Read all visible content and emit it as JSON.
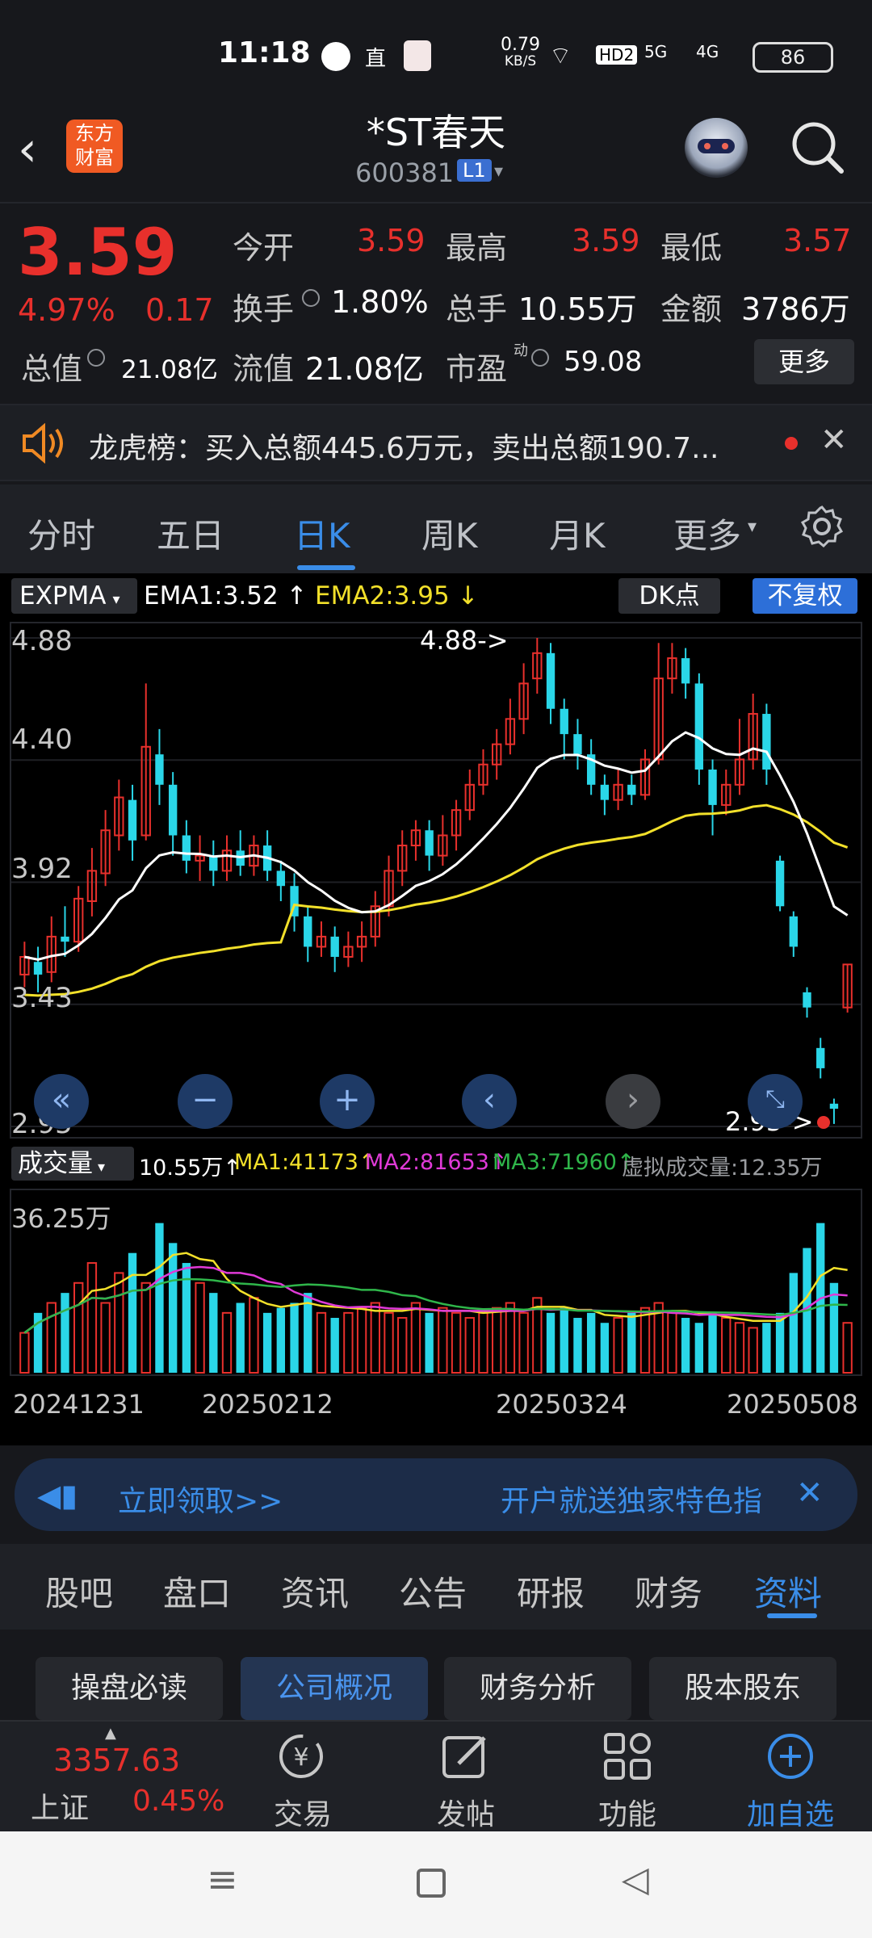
{
  "status_bar": {
    "time": "11:18",
    "net_speed": "0.79",
    "net_unit": "KB/S",
    "direct_label": "直",
    "hd": "HD2",
    "sig1": "5G",
    "sig2": "4G",
    "battery": "86"
  },
  "header": {
    "back_icon": "chevron-left-icon",
    "logo_line1": "东方",
    "logo_line2": "财富",
    "title": "*ST春天",
    "code": "600381",
    "level_badge": "L1"
  },
  "quote": {
    "price": "3.59",
    "change_pct": "4.97%",
    "change": "0.17",
    "market_cap_label": "总值",
    "market_cap": "21.08亿",
    "open_label": "今开",
    "open": "3.59",
    "high_label": "最高",
    "high": "3.59",
    "low_label": "最低",
    "low": "3.57",
    "turnover_label": "换手",
    "turnover": "1.80%",
    "volume_label": "总手",
    "volume": "10.55万",
    "amount_label": "金额",
    "amount": "3786万",
    "float_cap_label": "流值",
    "float_cap": "21.08亿",
    "pe_label": "市盈",
    "pe_sup": "动",
    "pe": "59.08",
    "more_label": "更多"
  },
  "dragon_tiger": {
    "text": "龙虎榜：买入总额445.6万元，卖出总额190.7..."
  },
  "period_tabs": [
    "分时",
    "五日",
    "日K",
    "周K",
    "月K",
    "更多"
  ],
  "active_period": "日K",
  "indicator": {
    "name": "EXPMA",
    "ema1": "EMA1:3.52",
    "ema2": "EMA2:3.95",
    "dk_label": "DK点",
    "adjust_label": "不复权"
  },
  "chart_data": {
    "type": "candlestick",
    "y_ticks": [
      "4.88",
      "4.40",
      "3.92",
      "3.43",
      "2.95"
    ],
    "ylim": [
      2.95,
      4.88
    ],
    "high_marker": "4.88->",
    "low_marker": "2.95->",
    "x_ticks": [
      "20241231",
      "20250212",
      "20250324",
      "20250508"
    ],
    "candles": [
      {
        "o": 3.55,
        "c": 3.62,
        "h": 3.68,
        "l": 3.5
      },
      {
        "o": 3.6,
        "c": 3.55,
        "h": 3.66,
        "l": 3.48
      },
      {
        "o": 3.56,
        "c": 3.7,
        "h": 3.78,
        "l": 3.52
      },
      {
        "o": 3.7,
        "c": 3.68,
        "h": 3.82,
        "l": 3.62
      },
      {
        "o": 3.68,
        "c": 3.85,
        "h": 3.9,
        "l": 3.64
      },
      {
        "o": 3.84,
        "c": 3.96,
        "h": 4.05,
        "l": 3.78
      },
      {
        "o": 3.95,
        "c": 4.12,
        "h": 4.2,
        "l": 3.9
      },
      {
        "o": 4.1,
        "c": 4.25,
        "h": 4.32,
        "l": 4.04
      },
      {
        "o": 4.24,
        "c": 4.08,
        "h": 4.3,
        "l": 4.0
      },
      {
        "o": 4.1,
        "c": 4.45,
        "h": 4.7,
        "l": 4.08
      },
      {
        "o": 4.42,
        "c": 4.3,
        "h": 4.52,
        "l": 4.22
      },
      {
        "o": 4.3,
        "c": 4.1,
        "h": 4.35,
        "l": 4.02
      },
      {
        "o": 4.1,
        "c": 4.0,
        "h": 4.16,
        "l": 3.95
      },
      {
        "o": 4.0,
        "c": 4.02,
        "h": 4.1,
        "l": 3.92
      },
      {
        "o": 4.02,
        "c": 3.96,
        "h": 4.08,
        "l": 3.9
      },
      {
        "o": 3.96,
        "c": 4.04,
        "h": 4.1,
        "l": 3.92
      },
      {
        "o": 4.04,
        "c": 3.98,
        "h": 4.12,
        "l": 3.94
      },
      {
        "o": 3.98,
        "c": 4.06,
        "h": 4.1,
        "l": 3.94
      },
      {
        "o": 4.06,
        "c": 3.96,
        "h": 4.12,
        "l": 3.92
      },
      {
        "o": 3.96,
        "c": 3.9,
        "h": 4.0,
        "l": 3.84
      },
      {
        "o": 3.9,
        "c": 3.78,
        "h": 3.95,
        "l": 3.72
      },
      {
        "o": 3.78,
        "c": 3.66,
        "h": 3.82,
        "l": 3.6
      },
      {
        "o": 3.66,
        "c": 3.7,
        "h": 3.76,
        "l": 3.62
      },
      {
        "o": 3.7,
        "c": 3.62,
        "h": 3.74,
        "l": 3.56
      },
      {
        "o": 3.62,
        "c": 3.66,
        "h": 3.72,
        "l": 3.58
      },
      {
        "o": 3.66,
        "c": 3.7,
        "h": 3.76,
        "l": 3.6
      },
      {
        "o": 3.7,
        "c": 3.82,
        "h": 3.88,
        "l": 3.66
      },
      {
        "o": 3.82,
        "c": 3.96,
        "h": 4.02,
        "l": 3.78
      },
      {
        "o": 3.96,
        "c": 4.06,
        "h": 4.12,
        "l": 3.9
      },
      {
        "o": 4.06,
        "c": 4.12,
        "h": 4.16,
        "l": 4.0
      },
      {
        "o": 4.12,
        "c": 4.02,
        "h": 4.16,
        "l": 3.96
      },
      {
        "o": 4.02,
        "c": 4.1,
        "h": 4.18,
        "l": 3.98
      },
      {
        "o": 4.1,
        "c": 4.2,
        "h": 4.24,
        "l": 4.04
      },
      {
        "o": 4.2,
        "c": 4.3,
        "h": 4.36,
        "l": 4.16
      },
      {
        "o": 4.3,
        "c": 4.38,
        "h": 4.44,
        "l": 4.26
      },
      {
        "o": 4.38,
        "c": 4.46,
        "h": 4.52,
        "l": 4.32
      },
      {
        "o": 4.46,
        "c": 4.56,
        "h": 4.64,
        "l": 4.42
      },
      {
        "o": 4.56,
        "c": 4.7,
        "h": 4.78,
        "l": 4.5
      },
      {
        "o": 4.72,
        "c": 4.82,
        "h": 4.88,
        "l": 4.66
      },
      {
        "o": 4.82,
        "c": 4.6,
        "h": 4.86,
        "l": 4.54
      },
      {
        "o": 4.6,
        "c": 4.5,
        "h": 4.64,
        "l": 4.4
      },
      {
        "o": 4.5,
        "c": 4.42,
        "h": 4.56,
        "l": 4.36
      },
      {
        "o": 4.42,
        "c": 4.3,
        "h": 4.48,
        "l": 4.26
      },
      {
        "o": 4.3,
        "c": 4.24,
        "h": 4.34,
        "l": 4.18
      },
      {
        "o": 4.24,
        "c": 4.3,
        "h": 4.36,
        "l": 4.2
      },
      {
        "o": 4.3,
        "c": 4.26,
        "h": 4.34,
        "l": 4.22
      },
      {
        "o": 4.26,
        "c": 4.4,
        "h": 4.44,
        "l": 4.24
      },
      {
        "o": 4.4,
        "c": 4.72,
        "h": 4.86,
        "l": 4.38
      },
      {
        "o": 4.72,
        "c": 4.8,
        "h": 4.86,
        "l": 4.66
      },
      {
        "o": 4.8,
        "c": 4.7,
        "h": 4.84,
        "l": 4.64
      },
      {
        "o": 4.7,
        "c": 4.36,
        "h": 4.74,
        "l": 4.3
      },
      {
        "o": 4.36,
        "c": 4.22,
        "h": 4.4,
        "l": 4.1
      },
      {
        "o": 4.22,
        "c": 4.3,
        "h": 4.36,
        "l": 4.18
      },
      {
        "o": 4.3,
        "c": 4.4,
        "h": 4.56,
        "l": 4.26
      },
      {
        "o": 4.4,
        "c": 4.58,
        "h": 4.66,
        "l": 4.36
      },
      {
        "o": 4.58,
        "c": 4.36,
        "h": 4.62,
        "l": 4.3
      },
      {
        "o": 4.0,
        "c": 3.82,
        "h": 4.02,
        "l": 3.8
      },
      {
        "o": 3.78,
        "c": 3.66,
        "h": 3.8,
        "l": 3.62
      },
      {
        "o": 3.48,
        "c": 3.42,
        "h": 3.5,
        "l": 3.38
      },
      {
        "o": 3.26,
        "c": 3.18,
        "h": 3.3,
        "l": 3.14
      },
      {
        "o": 3.04,
        "c": 3.02,
        "h": 3.06,
        "l": 2.96
      },
      {
        "o": 3.42,
        "c": 3.59,
        "h": 3.59,
        "l": 3.4
      }
    ],
    "volume_title": "成交量",
    "volume_ticks": [
      "36.25万"
    ],
    "volume_ylim": [
      0,
      36.25
    ],
    "volume_values": [
      8,
      12,
      14,
      16,
      18,
      22,
      14,
      20,
      24,
      18,
      30,
      26,
      22,
      18,
      16,
      12,
      14,
      15,
      12,
      13,
      14,
      16,
      12,
      11,
      12,
      13,
      14,
      12,
      11,
      14,
      12,
      13,
      12,
      11,
      12,
      13,
      14,
      12,
      15,
      12,
      13,
      11,
      12,
      10,
      11,
      12,
      13,
      14,
      12,
      11,
      10,
      12,
      11,
      10,
      9,
      10,
      12,
      20,
      25,
      30,
      18,
      10
    ]
  },
  "volume_legend": {
    "vol": "10.55万",
    "ma1": "MA1:41173",
    "ma2": "MA2:81653",
    "ma3": "MA3:71960",
    "virtual": "虚拟成交量:12.35万"
  },
  "ad": {
    "link": "立即领取>>",
    "text": "开户就送独家特色指"
  },
  "content_tabs": [
    "股吧",
    "盘口",
    "资讯",
    "公告",
    "研报",
    "财务",
    "资料"
  ],
  "active_content_tab": "资料",
  "sub_tabs": [
    "操盘必读",
    "公司概况",
    "财务分析",
    "股本股东"
  ],
  "active_sub_tab": "公司概况",
  "bottom_bar": {
    "index_value": "3357.63",
    "index_name": "上证",
    "index_change": "0.45%",
    "trade": "交易",
    "post": "发帖",
    "functions": "功能",
    "add_watch": "加自选"
  },
  "colors": {
    "up": "#e8302c",
    "down": "#2ad6e8",
    "ema1": "#ffffff",
    "ema2": "#f2e02a",
    "accent": "#3a8de8"
  }
}
